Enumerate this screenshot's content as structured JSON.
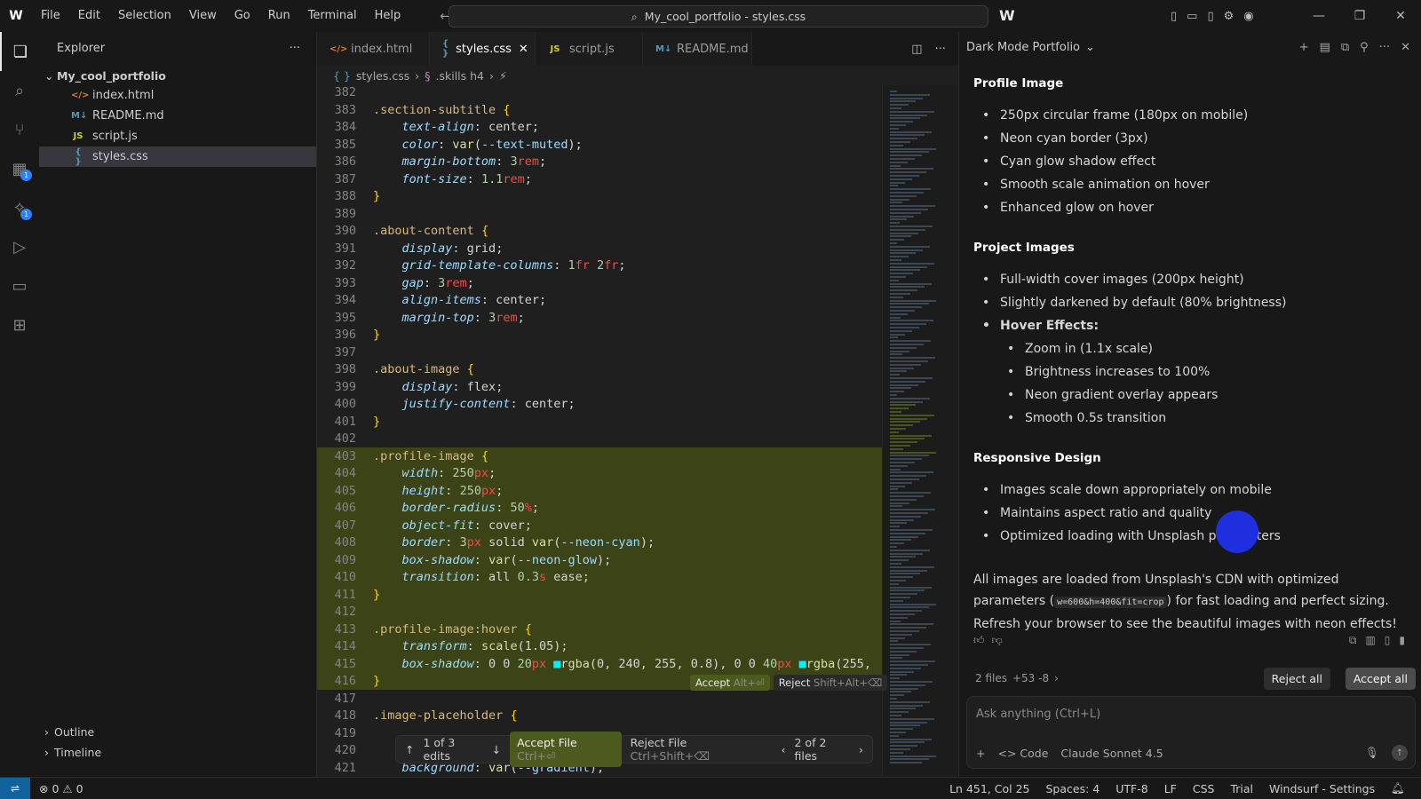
{
  "menu": [
    "File",
    "Edit",
    "Selection",
    "View",
    "Go",
    "Run",
    "Terminal",
    "Help"
  ],
  "command_center": "My_cool_portfolio - styles.css",
  "sidebar": {
    "title": "Explorer",
    "root": "My_cool_portfolio",
    "files": [
      {
        "name": "index.html",
        "icon": "html-file-icon",
        "badge": "</>"
      },
      {
        "name": "README.md",
        "icon": "markdown-file-icon",
        "badge": "M↓"
      },
      {
        "name": "script.js",
        "icon": "js-file-icon",
        "badge": "JS"
      },
      {
        "name": "styles.css",
        "icon": "css-file-icon",
        "badge": "{ }"
      }
    ],
    "outline": "Outline",
    "timeline": "Timeline"
  },
  "tabs": [
    {
      "label": "index.html",
      "badge": "</>"
    },
    {
      "label": "styles.css",
      "badge": "{ }"
    },
    {
      "label": "script.js",
      "badge": "JS"
    },
    {
      "label": "README.md",
      "badge": "M↓"
    }
  ],
  "breadcrumb": {
    "file": "styles.css",
    "symbol": ".skills h4"
  },
  "code": [
    {
      "n": "382",
      "t": ""
    },
    {
      "n": "383",
      "t": ".section-subtitle {"
    },
    {
      "n": "384",
      "t": "    text-align: center;"
    },
    {
      "n": "385",
      "t": "    color: var(--text-muted);"
    },
    {
      "n": "386",
      "t": "    margin-bottom: 3rem;"
    },
    {
      "n": "387",
      "t": "    font-size: 1.1rem;"
    },
    {
      "n": "388",
      "t": "}"
    },
    {
      "n": "389",
      "t": ""
    },
    {
      "n": "390",
      "t": ".about-content {"
    },
    {
      "n": "391",
      "t": "    display: grid;"
    },
    {
      "n": "392",
      "t": "    grid-template-columns: 1fr 2fr;"
    },
    {
      "n": "393",
      "t": "    gap: 3rem;"
    },
    {
      "n": "394",
      "t": "    align-items: center;"
    },
    {
      "n": "395",
      "t": "    margin-top: 3rem;"
    },
    {
      "n": "396",
      "t": "}"
    },
    {
      "n": "397",
      "t": ""
    },
    {
      "n": "398",
      "t": ".about-image {"
    },
    {
      "n": "399",
      "t": "    display: flex;"
    },
    {
      "n": "400",
      "t": "    justify-content: center;"
    },
    {
      "n": "401",
      "t": "}"
    },
    {
      "n": "402",
      "t": ""
    },
    {
      "n": "403",
      "t": ".profile-image {"
    },
    {
      "n": "404",
      "t": "    width: 250px;"
    },
    {
      "n": "405",
      "t": "    height: 250px;"
    },
    {
      "n": "406",
      "t": "    border-radius: 50%;"
    },
    {
      "n": "407",
      "t": "    object-fit: cover;"
    },
    {
      "n": "408",
      "t": "    border: 3px solid var(--neon-cyan);"
    },
    {
      "n": "409",
      "t": "    box-shadow: var(--neon-glow);"
    },
    {
      "n": "410",
      "t": "    transition: all 0.3s ease;"
    },
    {
      "n": "411",
      "t": "}"
    },
    {
      "n": "412",
      "t": ""
    },
    {
      "n": "413",
      "t": ".profile-image:hover {"
    },
    {
      "n": "414",
      "t": "    transform: scale(1.05);"
    },
    {
      "n": "415",
      "t": "    box-shadow: 0 0 20px ■rgba(0, 240, 255, 0.8), 0 0 40px ■rgba(255,"
    },
    {
      "n": "416",
      "t": "}"
    },
    {
      "n": "417",
      "t": ""
    },
    {
      "n": "418",
      "t": ".image-placeholder {"
    },
    {
      "n": "419",
      "t": ""
    },
    {
      "n": "420",
      "t": ""
    },
    {
      "n": "421",
      "t": "    background: var(--gradient);"
    }
  ],
  "highlighted_lines": [
    "403",
    "404",
    "405",
    "406",
    "407",
    "408",
    "409",
    "410",
    "411",
    "412",
    "413",
    "414",
    "415",
    "416"
  ],
  "inline_actions": {
    "accept": "Accept",
    "accept_key": "Alt+⏎",
    "reject": "Reject",
    "reject_key": "Shift+Alt+⌫"
  },
  "review_bar": {
    "edits": "1 of 3 edits",
    "accept_file": "Accept File",
    "accept_key": "Ctrl+⏎",
    "reject_file": "Reject File",
    "reject_key": "Ctrl+Shift+⌫",
    "files": "2 of 2 files"
  },
  "chat": {
    "title": "Dark Mode Portfolio",
    "sections": [
      {
        "heading": "Profile Image",
        "items": [
          {
            "text": "250px circular frame (180px on mobile)",
            "level": 1
          },
          {
            "text": "Neon cyan border (3px)",
            "level": 1
          },
          {
            "text": "Cyan glow shadow effect",
            "level": 1
          },
          {
            "text": "Smooth scale animation on hover",
            "level": 1
          },
          {
            "text": "Enhanced glow on hover",
            "level": 1
          }
        ]
      },
      {
        "heading": "Project Images",
        "items": [
          {
            "text": "Full-width cover images (200px height)",
            "level": 1
          },
          {
            "text": "Slightly darkened by default (80% brightness)",
            "level": 1
          },
          {
            "text": "Hover Effects:",
            "level": 1,
            "bold": true
          },
          {
            "text": "Zoom in (1.1x scale)",
            "level": 2
          },
          {
            "text": "Brightness increases to 100%",
            "level": 2
          },
          {
            "text": "Neon gradient overlay appears",
            "level": 2
          },
          {
            "text": "Smooth 0.5s transition",
            "level": 2
          }
        ]
      },
      {
        "heading": "Responsive Design",
        "items": [
          {
            "text": "Images scale down appropriately on mobile",
            "level": 1
          },
          {
            "text": "Maintains aspect ratio and quality",
            "level": 1
          },
          {
            "text": "Optimized loading with Unsplash parameters",
            "level": 1
          }
        ]
      }
    ],
    "closing_a": "All images are loaded from Unsplash's CDN with optimized parameters (",
    "closing_code": "w=600&h=400&fit=crop",
    "closing_b": ") for fast loading and perfect sizing. Refresh your browser to see the beautiful images with neon effects!",
    "files_summary": "2 files",
    "diff_stats": "+53 -8",
    "reject_all": "Reject all",
    "accept_all": "Accept all",
    "input_placeholder": "Ask anything (Ctrl+L)",
    "mode": "Code",
    "model": "Claude Sonnet 4.5"
  },
  "status": {
    "errors": "0",
    "warnings": "0",
    "position": "Ln 451, Col 25",
    "spaces": "Spaces: 4",
    "encoding": "UTF-8",
    "eol": "LF",
    "language": "CSS",
    "plan": "Trial",
    "settings": "Windsurf - Settings"
  },
  "colors": {
    "accent_blue": "#0e639c",
    "diff_highlight": "#3b4317",
    "accept_green": "#4d5a1d",
    "cursor_blue": "#1f2fe0"
  }
}
